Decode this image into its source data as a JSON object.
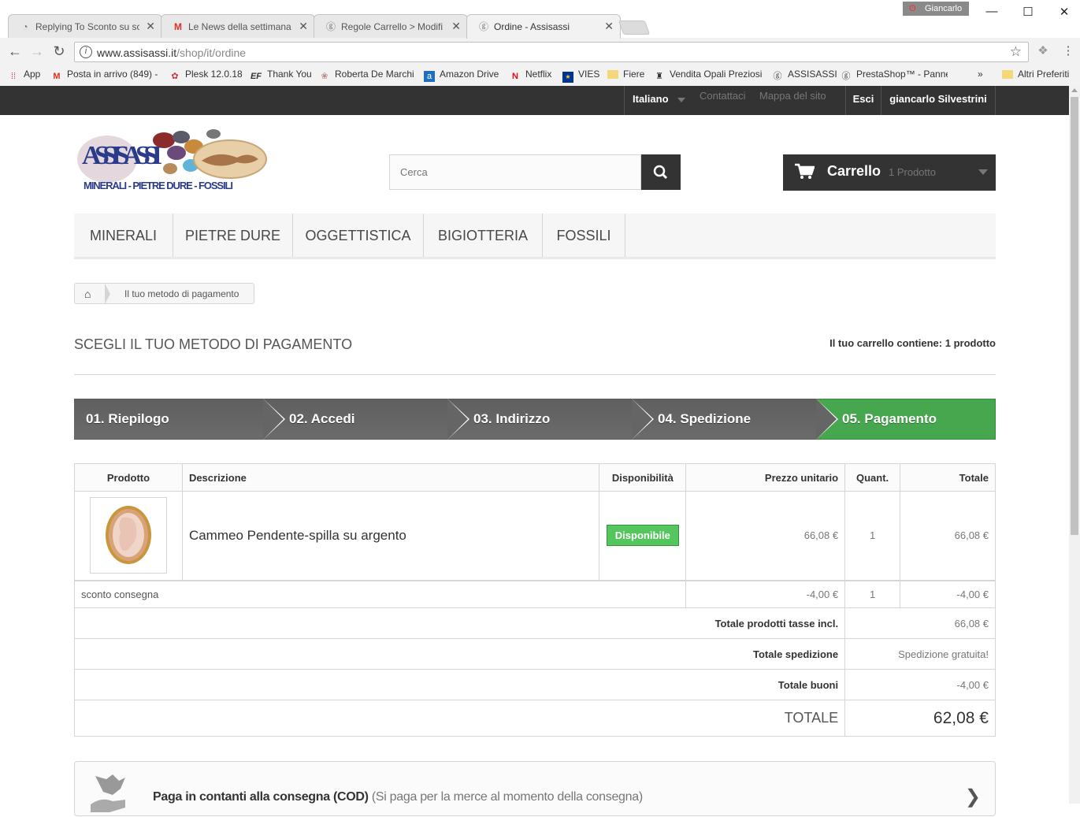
{
  "browser": {
    "tabs": [
      {
        "title": "Replying To Sconto su sc",
        "icon": "forum-icon"
      },
      {
        "title": "Le News della settimana",
        "icon": "gmail-icon"
      },
      {
        "title": "Regole Carrello > Modifi",
        "icon": "prestashop-icon"
      },
      {
        "title": "Ordine - Assisassi",
        "icon": "prestashop-icon"
      }
    ],
    "profile": "Giancarlo",
    "url_host": "www.assisassi.it",
    "url_path": "/shop/it/ordine",
    "bookmarks": [
      {
        "label": "App",
        "icon": "apps-icon"
      },
      {
        "label": "Posta in arrivo (849) -",
        "icon": "gmail-icon"
      },
      {
        "label": "Plesk 12.0.18",
        "icon": "plesk-icon"
      },
      {
        "label": "Thank You",
        "icon": "ef-icon"
      },
      {
        "label": "Roberta De Marchi",
        "icon": "flower-icon"
      },
      {
        "label": "Amazon Drive",
        "icon": "amazon-icon"
      },
      {
        "label": "Netflix",
        "icon": "netflix-icon"
      },
      {
        "label": "VIES",
        "icon": "eu-flag-icon"
      },
      {
        "label": "Fiere",
        "icon": "folder-icon"
      },
      {
        "label": "Vendita Opali Preziosi",
        "icon": "opal-icon"
      },
      {
        "label": "ASSISASSI",
        "icon": "prestashop-icon"
      },
      {
        "label": "PrestaShop™ - Pannel",
        "icon": "prestashop-icon"
      }
    ],
    "more_bookmarks": "»",
    "other_bookmarks": "Altri Preferiti"
  },
  "topbar": {
    "language": "Italiano",
    "contact": "Contattaci",
    "sitemap": "Mappa del sito",
    "logout": "Esci",
    "user": "giancarlo Silvestrini"
  },
  "header": {
    "logo_title": "ASSISASSI",
    "logo_subtitle": "MINERALI - PIETRE DURE - FOSSILI",
    "search_placeholder": "Cerca",
    "cart_label": "Carrello",
    "cart_count": "1 Prodotto"
  },
  "menu": [
    "MINERALI",
    "PIETRE DURE",
    "OGGETTISTICA",
    "BIGIOTTERIA",
    "FOSSILI"
  ],
  "breadcrumb": "Il tuo metodo di pagamento",
  "page": {
    "title": "SCEGLI IL TUO METODO DI PAGAMENTO",
    "summary": "Il tuo carrello contiene: 1 prodotto"
  },
  "steps": [
    "01. Riepilogo",
    "02. Accedi",
    "03. Indirizzo",
    "04. Spedizione",
    "05. Pagamento"
  ],
  "table": {
    "headers": {
      "product": "Prodotto",
      "description": "Descrizione",
      "availability": "Disponibilità",
      "unit_price": "Prezzo unitario",
      "qty": "Quant.",
      "total": "Totale"
    },
    "item": {
      "description": "Cammeo Pendente-spilla su argento",
      "availability": "Disponibile",
      "unit_price": "66,08 €",
      "qty": "1",
      "total": "66,08 €"
    },
    "discount": {
      "label": "sconto consegna",
      "unit_price": "-4,00 €",
      "qty": "1",
      "total": "-4,00 €"
    },
    "totals": {
      "products_label": "Totale prodotti tasse incl.",
      "products_value": "66,08 €",
      "shipping_label": "Totale spedizione",
      "shipping_value": "Spedizione gratuita!",
      "vouchers_label": "Totale buoni",
      "vouchers_value": "-4,00 €",
      "grand_label": "TOTALE",
      "grand_value": "62,08 €"
    }
  },
  "payment": {
    "title": "Paga in contanti alla consegna (COD)",
    "note": "(Si paga per la merce al momento della consegna)"
  },
  "colors": {
    "dark": "#333333",
    "accent_green": "#46a74e",
    "step_grey": "#6b6b6b"
  }
}
